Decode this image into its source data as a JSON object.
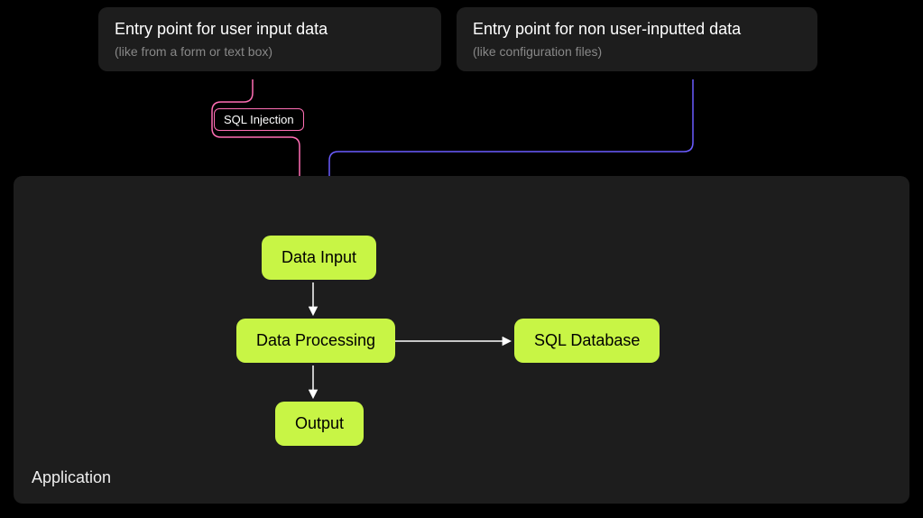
{
  "entry_points": {
    "user_input": {
      "title": "Entry point for user input data",
      "subtitle": "(like from a form or text box)"
    },
    "non_user_input": {
      "title": "Entry point for non user-inputted data",
      "subtitle": "(like configuration files)"
    }
  },
  "badge": {
    "sql_injection": "SQL Injection"
  },
  "application": {
    "label": "Application",
    "nodes": {
      "data_input": "Data Input",
      "data_processing": "Data Processing",
      "output": "Output",
      "sql_database": "SQL Database"
    }
  },
  "colors": {
    "pink": "#ff6eb4",
    "purple": "#6b5cff",
    "green": "#c8f545",
    "white": "#ffffff"
  }
}
